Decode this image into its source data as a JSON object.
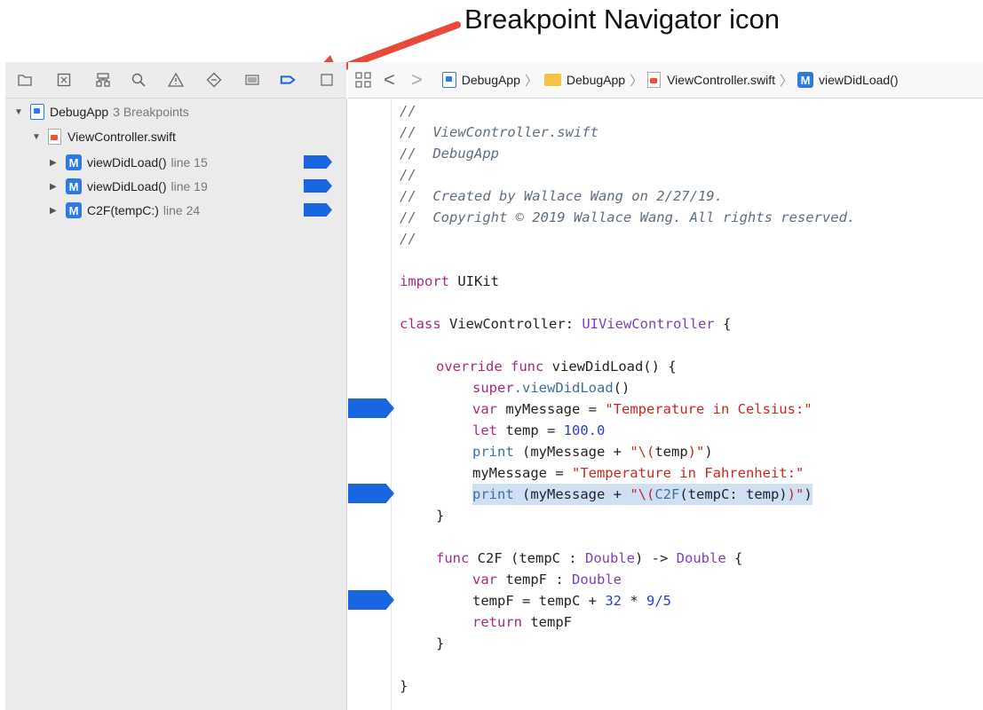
{
  "caption": "Breakpoint Navigator icon",
  "navigator_tabs": [
    "folder-icon",
    "source-control-icon",
    "symbol-icon",
    "search-icon",
    "warning-icon",
    "test-icon",
    "debug-icon",
    "breakpoint-icon",
    "report-icon"
  ],
  "navigator": {
    "project": {
      "name": "DebugApp",
      "detail": "3 Breakpoints"
    },
    "file": "ViewController.swift",
    "breakpoints": [
      {
        "badge": "M",
        "name": "viewDidLoad()",
        "detail": "line 15"
      },
      {
        "badge": "M",
        "name": "viewDidLoad()",
        "detail": "line 19"
      },
      {
        "badge": "M",
        "name": "C2F(tempC:)",
        "detail": "line 24"
      }
    ]
  },
  "jumpbar": {
    "back": "<",
    "forward": ">",
    "items": [
      "DebugApp",
      "DebugApp",
      "ViewController.swift",
      "viewDidLoad()"
    ],
    "method_badge": "M"
  },
  "code": {
    "l01": "//",
    "l02": "//  ViewController.swift",
    "l03": "//  DebugApp",
    "l04": "//",
    "l05": "//  Created by Wallace Wang on 2/27/19.",
    "l06": "//  Copyright © 2019 Wallace Wang. All rights reserved.",
    "l07": "//",
    "import_kw": "import",
    "import_mod": " UIKit",
    "class_kw": "class",
    "class_name": " ViewController: ",
    "class_super": "UIViewController",
    "class_open": " {",
    "override_kw": "override",
    "func_kw": " func",
    "vdl_sig": " viewDidLoad() {",
    "super_kw": "super",
    "super_call": ".viewDidLoad",
    "super_paren": "()",
    "var_kw": "var",
    "mymsg_decl": " myMessage = ",
    "str1": "\"Temperature in Celsius:\"",
    "let_kw": "let",
    "temp_decl": " temp = ",
    "num_100": "100.0",
    "print_fn": "print",
    "print1_a": " (myMessage + ",
    "print1_s1": "\"\\(",
    "print1_v": "temp",
    "print1_s2": ")\"",
    "print1_b": ")",
    "mymsg_assign": "myMessage = ",
    "str2": "\"Temperature in Fahrenheit:\"",
    "print2_a": " (myMessage + ",
    "print2_s1": "\"\\(",
    "print2_call": "C2F",
    "print2_v": "(tempC: temp)",
    "print2_s2": ")\"",
    "print2_b": ")",
    "close1": "}",
    "func2_kw": "func",
    "c2f_sig_a": " C2F (tempC : ",
    "double1": "Double",
    "c2f_arrow": ") -> ",
    "double2": "Double",
    "c2f_open": " {",
    "var2_kw": "var",
    "tempf_decl": " tempF : ",
    "double3": "Double",
    "tempf_assign_a": "tempF = tempC + ",
    "num_32": "32",
    "op_mul": " * ",
    "num_95": "9/5",
    "return_kw": "return",
    "return_val": " tempF",
    "close2": "}",
    "close3": "}"
  }
}
